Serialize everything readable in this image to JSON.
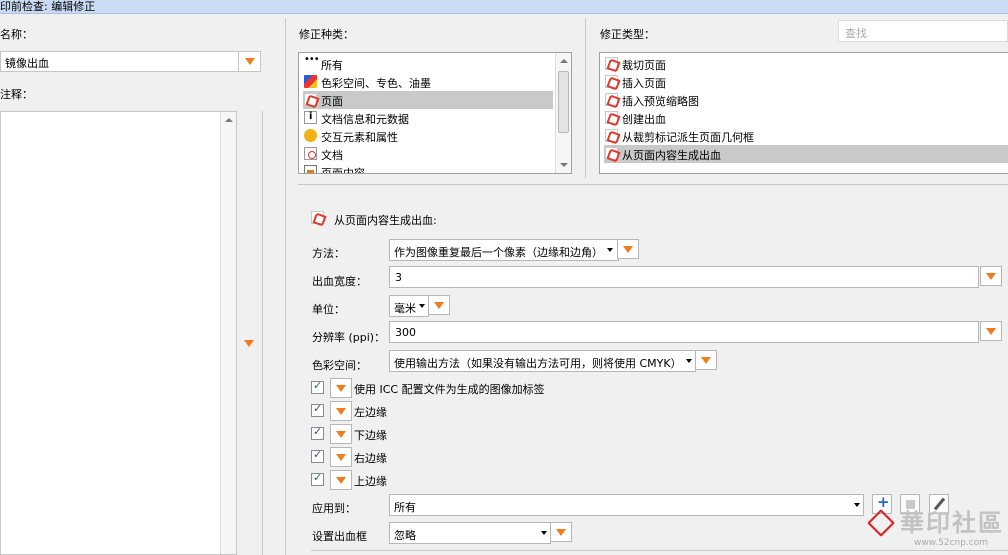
{
  "window": {
    "title": "印前检查: 编辑修正"
  },
  "left": {
    "name_label": "名称：",
    "name_value": "镜像出血",
    "notes_label": "注释："
  },
  "categories": {
    "label": "修正种类：",
    "items": [
      {
        "icon": "dots-icon",
        "label": "所有"
      },
      {
        "icon": "color-space-icon",
        "label": "色彩空间、专色、油墨"
      },
      {
        "icon": "pdf-page-icon",
        "label": "页面",
        "selected": true
      },
      {
        "icon": "doc-info-icon",
        "label": "文档信息和元数据"
      },
      {
        "icon": "comment-icon",
        "label": "交互元素和属性"
      },
      {
        "icon": "pdf-doc-icon",
        "label": "文档"
      },
      {
        "icon": "page-content-icon",
        "label": "页面内容"
      }
    ]
  },
  "types": {
    "label": "修正类型：",
    "search_placeholder": "查找",
    "items": [
      {
        "label": "裁切页面"
      },
      {
        "label": "插入页面"
      },
      {
        "label": "插入预览缩略图"
      },
      {
        "label": "创建出血"
      },
      {
        "label": "从裁剪标记派生页面几何框"
      },
      {
        "label": "从页面内容生成出血",
        "selected": true
      }
    ]
  },
  "detail": {
    "header": "从页面内容生成出血:",
    "method_label": "方法：",
    "method_value": "作为图像重复最后一个像素（边缘和边角）",
    "bleed_width_label": "出血宽度：",
    "bleed_width_value": "3",
    "unit_label": "单位：",
    "unit_value": "毫米",
    "resolution_label": "分辨率 (ppi)：",
    "resolution_value": "300",
    "color_space_label": "色彩空间：",
    "color_space_value": "使用输出方法（如果没有输出方法可用，则将使用 CMYK）",
    "checks": [
      {
        "label": "使用 ICC 配置文件为生成的图像加标签",
        "checked": true
      },
      {
        "label": "左边缘",
        "checked": true
      },
      {
        "label": "下边缘",
        "checked": true
      },
      {
        "label": "右边缘",
        "checked": true
      },
      {
        "label": "上边缘",
        "checked": true
      }
    ],
    "apply_label": "应用到：",
    "apply_value": "所有",
    "bleed_box_label": "设置出血框",
    "bleed_box_value": "忽略"
  },
  "watermark": {
    "text": "華印社區",
    "url": "www.52cnp.com"
  },
  "colors": {
    "accent_orange": "#f07d1d",
    "selection_gray": "#c9c9c9",
    "title_blue": "#c9dcf3"
  }
}
